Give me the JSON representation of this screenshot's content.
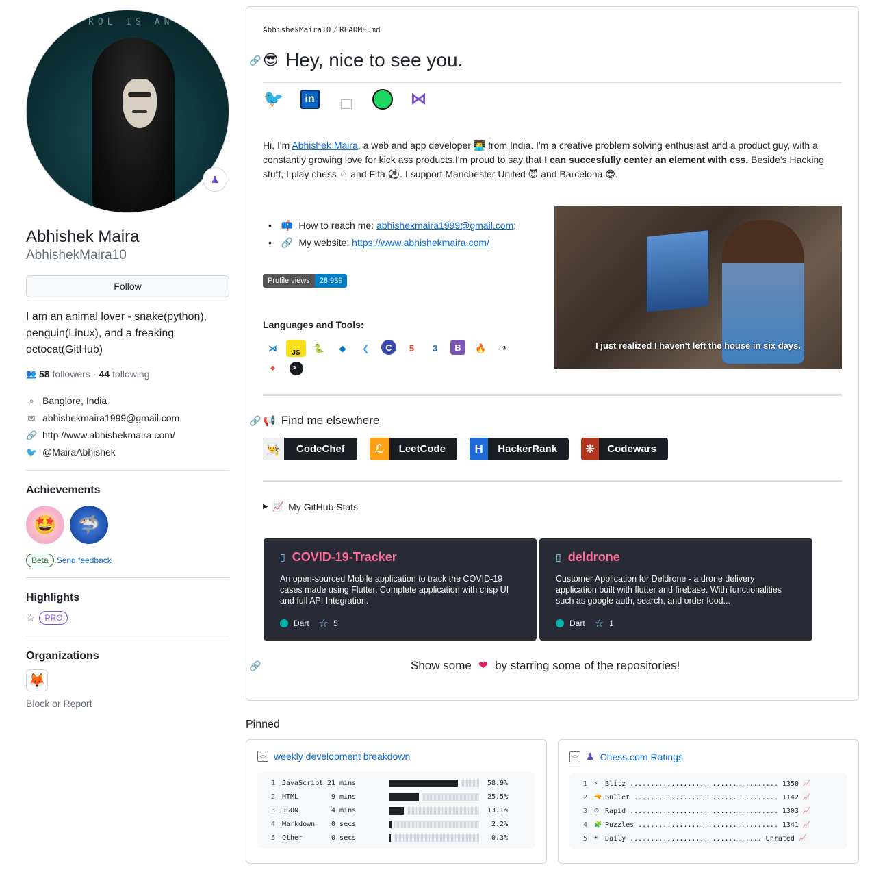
{
  "profile": {
    "avatar_banner": "ROL IS AN ILLU",
    "full_name": "Abhishek Maira",
    "login": "AbhishekMaira10",
    "follow_label": "Follow",
    "bio": "I am an animal lover - snake(python), penguin(Linux), and a freaking octocat(GitHub)",
    "followers_count": "58",
    "followers_label": "followers",
    "following_count": "44",
    "following_label": "following",
    "separator": "·",
    "location": "Banglore, India",
    "email": "abhishekmaira1999@gmail.com",
    "website": "http://www.abhishekmaira.com/",
    "twitter": "@MairaAbhishek",
    "achievements_title": "Achievements",
    "beta_label": "Beta",
    "feedback_label": "Send feedback",
    "highlights_title": "Highlights",
    "pro_label": "PRO",
    "organizations_title": "Organizations",
    "block_report": "Block or Report"
  },
  "readme": {
    "crumb_user": "AbhishekMaira10",
    "crumb_sep": "/",
    "crumb_file": "README.md",
    "heading": "Hey, nice to see you.",
    "intro_prefix": "Hi, I'm ",
    "intro_name": "Abhishek Maira",
    "intro_part1": ", a web and app developer 👨‍💻 from India. I'm a creative problem solving enthusiast and a product guy, with a constantly growing love for kick ass products.I'm proud to say that ",
    "intro_bold": "I can succesfully center an element with css.",
    "intro_part2": " Beside's Hacking stuff, I play chess ♘ and Fifa ⚽. I support Manchester United 😈 and Barcelona 😎.",
    "reach_label": "How to reach me: ",
    "reach_email": "abhishekmaira1999@gmail.com",
    "reach_suffix": ";",
    "website_label": "My website: ",
    "website_url": "https://www.abhishekmaira.com/",
    "views_label": "Profile views",
    "views_count": "28,939",
    "languages_title": "Languages and Tools:",
    "gif_caption": "I just realized I haven't left the house in six days.",
    "find_title": "Find me elsewhere",
    "platforms": [
      "CodeChef",
      "LeetCode",
      "HackerRank",
      "Codewars"
    ],
    "stats_label": "My GitHub Stats",
    "repos": [
      {
        "name": "COVID-19-Tracker",
        "desc": "An open-sourced Mobile application to track the COVID-19 cases made using Flutter. Complete application with crisp UI and full API Integration.",
        "lang": "Dart",
        "stars": "5"
      },
      {
        "name": "deldrone",
        "desc": "Customer Application for Deldrone - a drone delivery application built with flutter and firebase. With functionalities such as google auth, search, and order food...",
        "lang": "Dart",
        "stars": "1"
      }
    ],
    "show_prefix": "Show some",
    "show_suffix": "by starring some of the repositories!"
  },
  "pinned": {
    "title": "Pinned",
    "card1_title": "weekly development breakdown",
    "card2_title": "Chess.com Ratings",
    "weekly": [
      {
        "n": "1",
        "lang": "JavaScript",
        "time": "21 mins",
        "pct": "58.9%",
        "value": 0.589
      },
      {
        "n": "2",
        "lang": "HTML",
        "time": " 9 mins",
        "pct": "25.5%",
        "value": 0.255
      },
      {
        "n": "3",
        "lang": "JSON",
        "time": " 4 mins",
        "pct": "13.1%",
        "value": 0.131
      },
      {
        "n": "4",
        "lang": "Markdown",
        "time": " 0 secs",
        "pct": " 2.2%",
        "value": 0.022
      },
      {
        "n": "5",
        "lang": "Other",
        "time": " 0 secs",
        "pct": " 0.3%",
        "value": 0.003
      }
    ],
    "chess": [
      {
        "n": "1",
        "icon": "⚡",
        "line": "Blitz .................................... 1350"
      },
      {
        "n": "2",
        "icon": "🔫",
        "line": "Bullet ................................... 1142"
      },
      {
        "n": "3",
        "icon": "⏱",
        "line": "Rapid .................................... 1303"
      },
      {
        "n": "4",
        "icon": "🧩",
        "line": "Puzzles .................................. 1341"
      },
      {
        "n": "5",
        "icon": "☀",
        "line": "Daily ................................ Unrated"
      }
    ],
    "chart_icon": "📈"
  },
  "colors": {
    "accent": "#0969da",
    "repo_title": "#ff6e96",
    "repo_bg": "#282a36",
    "dart": "#00b4ab",
    "pro": "#8250df",
    "beta": "#1a7f37"
  }
}
